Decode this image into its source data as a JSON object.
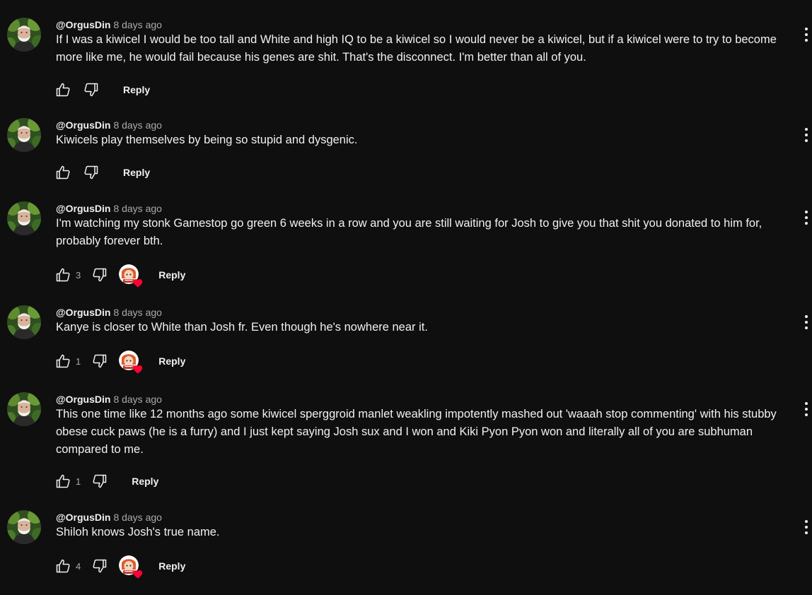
{
  "comments": [
    {
      "author": "@OrgusDin",
      "time": "8 days ago",
      "text": "If I was a kiwicel I would be too tall and White and high IQ to be a kiwicel so I would never be a kiwicel, but if a kiwicel were to try to become more like me, he would fail because his genes are shit. That's the disconnect. I'm better than all of you.",
      "likes": "",
      "creator_heart": false,
      "reply_label": "Reply"
    },
    {
      "author": "@OrgusDin",
      "time": "8 days ago",
      "text": "Kiwicels play themselves by being so stupid and dysgenic.",
      "likes": "",
      "creator_heart": false,
      "reply_label": "Reply"
    },
    {
      "author": "@OrgusDin",
      "time": "8 days ago",
      "text": "I'm watching my stonk Gamestop go green 6 weeks in a row and you are still waiting for Josh to give you that shit you donated to him for, probably forever bth.",
      "likes": "3",
      "creator_heart": true,
      "reply_label": "Reply"
    },
    {
      "author": "@OrgusDin",
      "time": "8 days ago",
      "text": "Kanye is closer to White than Josh fr. Even though he's nowhere near it.",
      "likes": "1",
      "creator_heart": true,
      "reply_label": "Reply"
    },
    {
      "author": "@OrgusDin",
      "time": "8 days ago",
      "text": "This one time like 12 months ago some kiwicel sperggroid manlet weakling impotently mashed out 'waaah stop commenting' with his stubby obese cuck paws (he is a furry) and I just kept saying Josh sux and I won and Kiki Pyon Pyon won and literally all of you are subhuman compared to me.",
      "likes": "1",
      "creator_heart": false,
      "reply_label": "Reply"
    },
    {
      "author": "@OrgusDin",
      "time": "8 days ago",
      "text": "Shiloh knows Josh's true name.",
      "likes": "4",
      "creator_heart": true,
      "reply_label": "Reply"
    }
  ],
  "icons": {
    "like": "thumbs-up-icon",
    "dislike": "thumbs-down-icon",
    "more": "more-vert-icon",
    "heart": "creator-heart-icon"
  },
  "colors": {
    "background": "#0f0f0f",
    "text": "#f1f1f1",
    "secondary": "#aaaaaa",
    "heart": "#ff0033"
  }
}
